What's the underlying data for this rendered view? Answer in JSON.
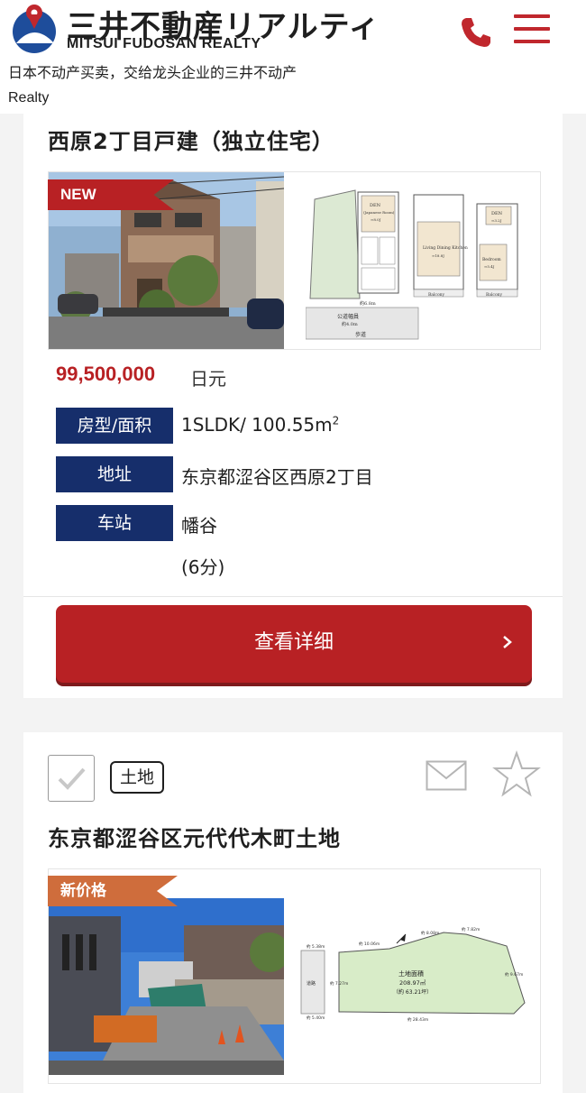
{
  "header": {
    "logo_jp": "三井不動産リアルティ",
    "logo_en": "MITSUI FUDOSAN REALTY",
    "tagline_line1": "日本不动产买卖，交给龙头企业的三井不动产",
    "tagline_line2": "Realty"
  },
  "listing1": {
    "title": "西原2丁目戸建（独立住宅）",
    "badge": "NEW",
    "price": "99,500,000",
    "price_unit": "日元",
    "specs": [
      {
        "label": "房型/面积",
        "value": "1SLDK/ 100.55m",
        "sup": "2"
      },
      {
        "label": "地址",
        "value": "东京都涩谷区西原2丁目"
      },
      {
        "label": "车站",
        "value": "幡谷",
        "sub": "(6分)"
      }
    ],
    "floorplan_labels": {
      "den1": "DEN",
      "den1_sub": "(Japanese Room)",
      "den1_size": "≈8.0J",
      "ldk": "Living Dining Kitchen",
      "ldk_size": "≈18.8J",
      "den2": "DEN",
      "den2_size": "≈3.2J",
      "bedroom": "Bedroom",
      "bedroom_size": "≈5.4J",
      "balcony1": "Balcony",
      "balcony2": "Balcony",
      "road_width": "公道幅員",
      "road_width_value": "約4.0m",
      "sidewalk": "歩道",
      "frontage": "約6.8m"
    },
    "detail_button": "查看详细"
  },
  "listing2": {
    "tag": "土地",
    "title": "东京都涩谷区元代代木町土地",
    "badge": "新价格",
    "plot_labels": {
      "area_title": "土地面積",
      "area_m2": "208.97㎡",
      "area_tsubo": "（約 63.21坪）",
      "road": "道路",
      "d1": "約 5.38m",
      "d2": "約 5.40m",
      "d3": "約 10.06m",
      "d4": "約 7.27m",
      "d5": "約 8.08m",
      "d6": "約 7.82m",
      "d7": "約 9.67m",
      "d8": "約 28.43m"
    }
  },
  "colors": {
    "brand_red": "#b82124",
    "spec_navy": "#162e6b",
    "price_ribbon": "#cf6d3c",
    "logo_blue": "#1e4d9b"
  },
  "icons": {
    "phone": "phone-icon",
    "menu": "hamburger-menu-icon",
    "checkbox": "check-icon",
    "mail": "mail-icon",
    "favorite": "star-icon",
    "chevron": "chevron-right-icon"
  }
}
